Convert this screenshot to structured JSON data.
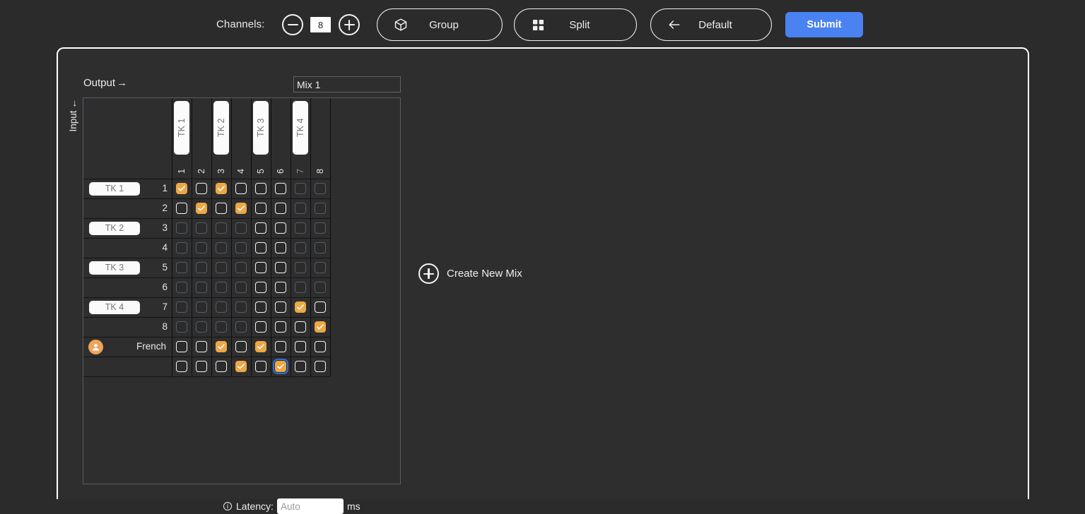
{
  "toolbar": {
    "channels_label": "Channels:",
    "channels_value": "8",
    "decrement_icon": "minus-icon",
    "increment_icon": "plus-icon",
    "group_label": "Group",
    "group_icon": "cube-icon",
    "split_label": "Split",
    "split_icon": "grid-icon",
    "default_label": "Default",
    "default_icon": "arrow-left-icon",
    "submit_label": "Submit",
    "submit_color": "#4a82f2"
  },
  "matrix": {
    "output_label": "Output",
    "output_arrow": "→",
    "input_label": "Input",
    "input_arrow": "←",
    "mix_name": "Mix 1",
    "column_inputs": [
      {
        "placeholder": "TK 1"
      },
      {
        "placeholder": "TK 2"
      },
      {
        "placeholder": "TK 3"
      },
      {
        "placeholder": "TK 4"
      }
    ],
    "column_numbers": [
      "1",
      "2",
      "3",
      "4",
      "5",
      "6",
      "7",
      "8"
    ],
    "column_disabled": [
      false,
      false,
      false,
      false,
      false,
      false,
      true,
      false
    ],
    "row_inputs": [
      {
        "placeholder": "TK 1"
      },
      {
        "placeholder": "TK 2"
      },
      {
        "placeholder": "TK 3"
      },
      {
        "placeholder": "TK 4"
      }
    ],
    "rows": [
      {
        "label": "1",
        "kind": "number",
        "cells": [
          {
            "state": "checked"
          },
          {
            "state": "unchecked"
          },
          {
            "state": "checked"
          },
          {
            "state": "unchecked"
          },
          {
            "state": "unchecked"
          },
          {
            "state": "unchecked"
          },
          {
            "state": "disabled"
          },
          {
            "state": "disabled"
          }
        ]
      },
      {
        "label": "2",
        "kind": "number",
        "cells": [
          {
            "state": "unchecked"
          },
          {
            "state": "checked"
          },
          {
            "state": "unchecked"
          },
          {
            "state": "checked"
          },
          {
            "state": "unchecked"
          },
          {
            "state": "unchecked"
          },
          {
            "state": "disabled"
          },
          {
            "state": "disabled"
          }
        ]
      },
      {
        "label": "3",
        "kind": "number",
        "cells": [
          {
            "state": "disabled"
          },
          {
            "state": "disabled"
          },
          {
            "state": "disabled"
          },
          {
            "state": "disabled"
          },
          {
            "state": "unchecked"
          },
          {
            "state": "unchecked"
          },
          {
            "state": "disabled"
          },
          {
            "state": "disabled"
          }
        ]
      },
      {
        "label": "4",
        "kind": "number",
        "cells": [
          {
            "state": "disabled"
          },
          {
            "state": "disabled"
          },
          {
            "state": "disabled"
          },
          {
            "state": "disabled"
          },
          {
            "state": "unchecked"
          },
          {
            "state": "unchecked"
          },
          {
            "state": "disabled"
          },
          {
            "state": "disabled"
          }
        ]
      },
      {
        "label": "5",
        "kind": "number",
        "cells": [
          {
            "state": "disabled"
          },
          {
            "state": "disabled"
          },
          {
            "state": "disabled"
          },
          {
            "state": "disabled"
          },
          {
            "state": "unchecked"
          },
          {
            "state": "unchecked"
          },
          {
            "state": "disabled"
          },
          {
            "state": "disabled"
          }
        ]
      },
      {
        "label": "6",
        "kind": "number",
        "cells": [
          {
            "state": "disabled"
          },
          {
            "state": "disabled"
          },
          {
            "state": "disabled"
          },
          {
            "state": "disabled"
          },
          {
            "state": "unchecked"
          },
          {
            "state": "unchecked"
          },
          {
            "state": "disabled"
          },
          {
            "state": "disabled"
          }
        ]
      },
      {
        "label": "7",
        "kind": "number",
        "cells": [
          {
            "state": "disabled"
          },
          {
            "state": "disabled"
          },
          {
            "state": "disabled"
          },
          {
            "state": "disabled"
          },
          {
            "state": "unchecked"
          },
          {
            "state": "unchecked"
          },
          {
            "state": "checked"
          },
          {
            "state": "unchecked"
          }
        ]
      },
      {
        "label": "8",
        "kind": "number",
        "cells": [
          {
            "state": "disabled"
          },
          {
            "state": "disabled"
          },
          {
            "state": "disabled"
          },
          {
            "state": "disabled"
          },
          {
            "state": "unchecked"
          },
          {
            "state": "unchecked"
          },
          {
            "state": "unchecked"
          },
          {
            "state": "checked"
          }
        ]
      },
      {
        "label": "French",
        "kind": "named",
        "avatar_icon": "user-avatar-icon",
        "avatar_color": "#f0a45a",
        "cells": [
          {
            "state": "unchecked"
          },
          {
            "state": "unchecked"
          },
          {
            "state": "checked"
          },
          {
            "state": "unchecked"
          },
          {
            "state": "checked"
          },
          {
            "state": "unchecked"
          },
          {
            "state": "unchecked"
          },
          {
            "state": "unchecked"
          }
        ]
      },
      {
        "label": "",
        "kind": "blank",
        "cells": [
          {
            "state": "unchecked"
          },
          {
            "state": "unchecked"
          },
          {
            "state": "unchecked"
          },
          {
            "state": "checked"
          },
          {
            "state": "unchecked"
          },
          {
            "state": "checked",
            "focused": true
          },
          {
            "state": "unchecked"
          },
          {
            "state": "unchecked"
          }
        ]
      }
    ],
    "latency": {
      "info_icon": "info-icon",
      "label": "Latency:",
      "placeholder": "Auto",
      "value": "",
      "unit": "ms"
    }
  },
  "create_new_mix": {
    "icon": "plus-circle-icon",
    "label": "Create New Mix"
  },
  "colors": {
    "background": "#2b2b2b",
    "panel": "#2e2e2e",
    "accent_checked": "#eca846",
    "accent_focus": "#2f6fdb",
    "submit": "#4a82f2"
  }
}
